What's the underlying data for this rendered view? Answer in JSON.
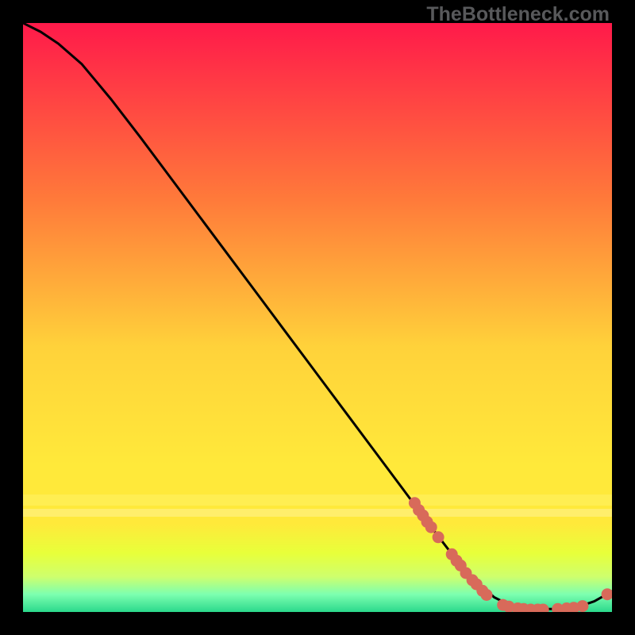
{
  "watermark": "TheBottleneck.com",
  "colors": {
    "top": "#ff1a4a",
    "mid1": "#ff7a3a",
    "mid2": "#ffd23a",
    "mid3": "#ffe93a",
    "mid4": "#e8ff3a",
    "band": "#ceff6d",
    "green": "#2bd98c",
    "curve": "#000000",
    "dot": "#d86a5a"
  },
  "chart_data": {
    "type": "line",
    "title": "",
    "xlabel": "",
    "ylabel": "",
    "xlim": [
      0,
      100
    ],
    "ylim": [
      0,
      100
    ],
    "curve": [
      {
        "x": 0,
        "y": 100
      },
      {
        "x": 3,
        "y": 98.5
      },
      {
        "x": 6,
        "y": 96.5
      },
      {
        "x": 10,
        "y": 93
      },
      {
        "x": 15,
        "y": 87
      },
      {
        "x": 20,
        "y": 80.5
      },
      {
        "x": 25,
        "y": 73.8
      },
      {
        "x": 30,
        "y": 67.1
      },
      {
        "x": 35,
        "y": 60.4
      },
      {
        "x": 40,
        "y": 53.7
      },
      {
        "x": 45,
        "y": 47.0
      },
      {
        "x": 50,
        "y": 40.3
      },
      {
        "x": 55,
        "y": 33.6
      },
      {
        "x": 60,
        "y": 26.9
      },
      {
        "x": 65,
        "y": 20.2
      },
      {
        "x": 70,
        "y": 13.5
      },
      {
        "x": 75,
        "y": 7.0
      },
      {
        "x": 80,
        "y": 2.5
      },
      {
        "x": 83,
        "y": 1.0
      },
      {
        "x": 86,
        "y": 0.5
      },
      {
        "x": 90,
        "y": 0.5
      },
      {
        "x": 94,
        "y": 0.8
      },
      {
        "x": 97,
        "y": 1.8
      },
      {
        "x": 100,
        "y": 3.5
      }
    ],
    "dots": [
      {
        "x": 66.5,
        "y": 18.5
      },
      {
        "x": 67.2,
        "y": 17.3
      },
      {
        "x": 67.9,
        "y": 16.4
      },
      {
        "x": 68.6,
        "y": 15.3
      },
      {
        "x": 69.3,
        "y": 14.4
      },
      {
        "x": 70.5,
        "y": 12.7
      },
      {
        "x": 72.8,
        "y": 9.8
      },
      {
        "x": 73.6,
        "y": 8.7
      },
      {
        "x": 74.3,
        "y": 7.9
      },
      {
        "x": 75.2,
        "y": 6.6
      },
      {
        "x": 76.3,
        "y": 5.4
      },
      {
        "x": 77.0,
        "y": 4.7
      },
      {
        "x": 78.0,
        "y": 3.6
      },
      {
        "x": 78.7,
        "y": 2.9
      },
      {
        "x": 81.5,
        "y": 1.2
      },
      {
        "x": 82.5,
        "y": 0.9
      },
      {
        "x": 84.0,
        "y": 0.6
      },
      {
        "x": 85.0,
        "y": 0.5
      },
      {
        "x": 86.2,
        "y": 0.4
      },
      {
        "x": 87.4,
        "y": 0.4
      },
      {
        "x": 88.3,
        "y": 0.4
      },
      {
        "x": 90.8,
        "y": 0.5
      },
      {
        "x": 92.3,
        "y": 0.6
      },
      {
        "x": 93.5,
        "y": 0.7
      },
      {
        "x": 95.0,
        "y": 1.0
      },
      {
        "x": 99.2,
        "y": 3.0
      }
    ]
  }
}
